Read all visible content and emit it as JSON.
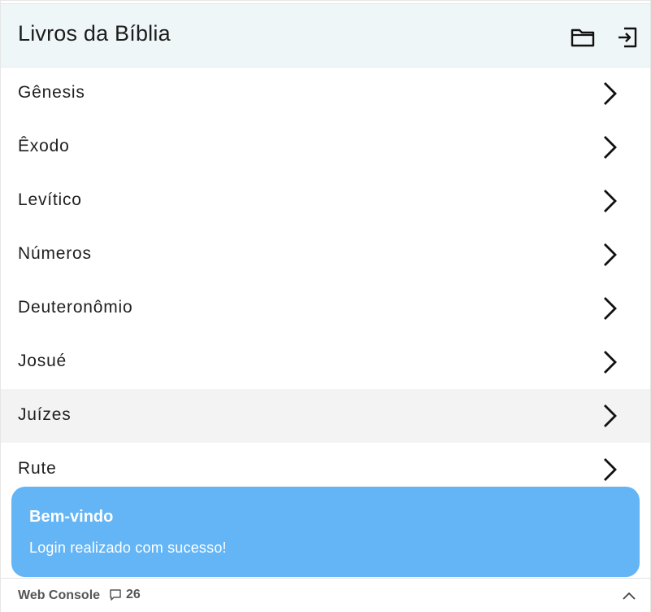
{
  "header": {
    "title": "Livros da Bíblia",
    "actions": [
      {
        "icon": "folder-icon"
      },
      {
        "icon": "logout-icon"
      }
    ]
  },
  "books": [
    {
      "label": "Gênesis"
    },
    {
      "label": "Êxodo"
    },
    {
      "label": "Levítico"
    },
    {
      "label": "Números"
    },
    {
      "label": "Deuteronômio"
    },
    {
      "label": "Josué"
    },
    {
      "label": "Juízes",
      "hovered": true
    },
    {
      "label": "Rute"
    }
  ],
  "toast": {
    "title": "Bem-vindo",
    "message": "Login realizado com sucesso!",
    "color": "#64b5f6"
  },
  "console": {
    "label": "Web Console",
    "count": "26",
    "icons": [
      "message-icon",
      "chevron-up-icon"
    ]
  },
  "colors": {
    "header_bg": "#eff6f7",
    "hover_bg": "#f3f3f3",
    "toast_bg": "#64b5f6"
  }
}
